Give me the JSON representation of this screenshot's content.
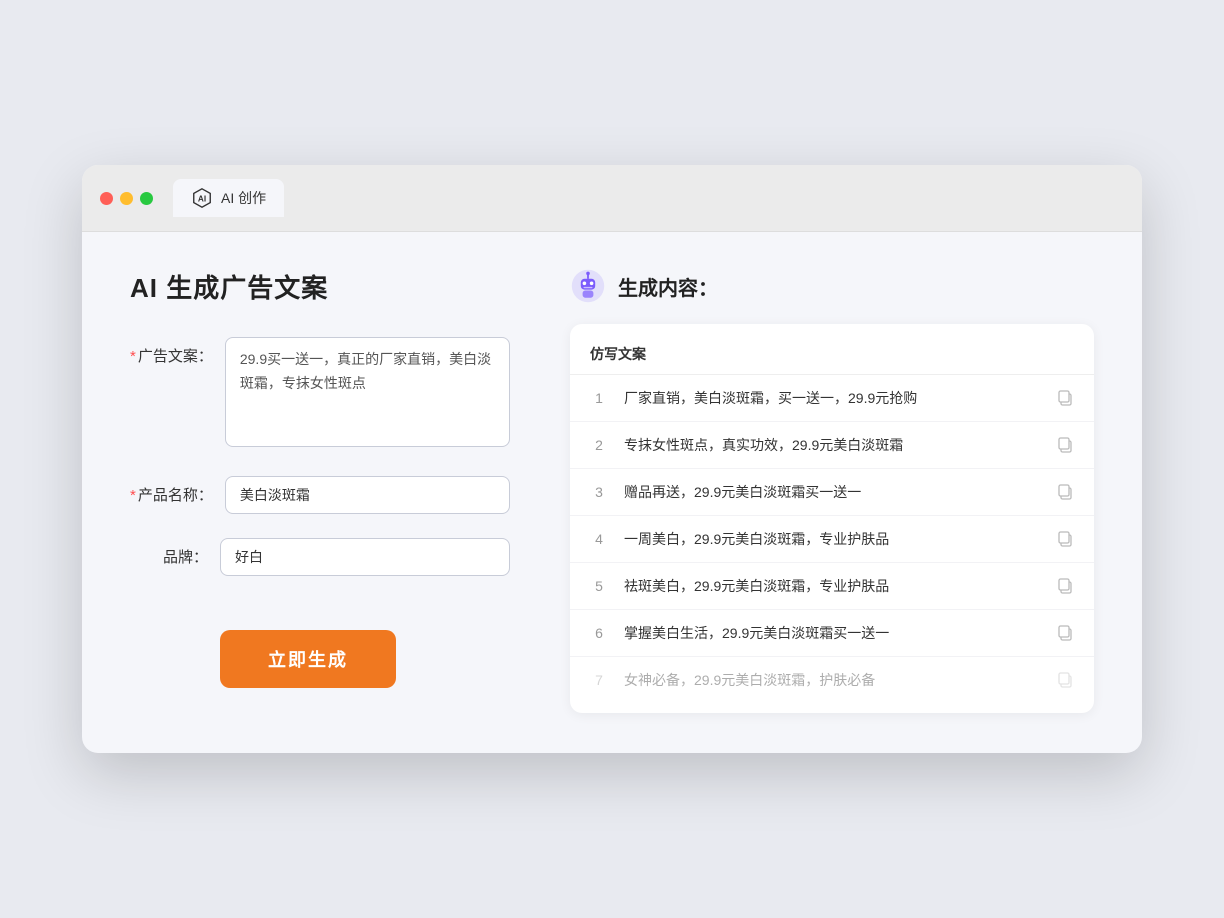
{
  "browser": {
    "tab_label": "AI 创作"
  },
  "page": {
    "title": "AI 生成广告文案",
    "result_title": "生成内容："
  },
  "form": {
    "ad_copy_label": "广告文案：",
    "ad_copy_required": true,
    "ad_copy_value": "29.9买一送一，真正的厂家直销，美白淡斑霜，专抹女性斑点",
    "product_name_label": "产品名称：",
    "product_name_required": true,
    "product_name_value": "美白淡斑霜",
    "brand_label": "品牌：",
    "brand_required": false,
    "brand_value": "好白",
    "generate_button_label": "立即生成"
  },
  "result": {
    "column_label": "仿写文案",
    "rows": [
      {
        "num": "1",
        "text": "厂家直销，美白淡斑霜，买一送一，29.9元抢购",
        "faded": false
      },
      {
        "num": "2",
        "text": "专抹女性斑点，真实功效，29.9元美白淡斑霜",
        "faded": false
      },
      {
        "num": "3",
        "text": "赠品再送，29.9元美白淡斑霜买一送一",
        "faded": false
      },
      {
        "num": "4",
        "text": "一周美白，29.9元美白淡斑霜，专业护肤品",
        "faded": false
      },
      {
        "num": "5",
        "text": "祛斑美白，29.9元美白淡斑霜，专业护肤品",
        "faded": false
      },
      {
        "num": "6",
        "text": "掌握美白生活，29.9元美白淡斑霜买一送一",
        "faded": false
      },
      {
        "num": "7",
        "text": "女神必备，29.9元美白淡斑霜，护肤必备",
        "faded": true
      }
    ]
  }
}
